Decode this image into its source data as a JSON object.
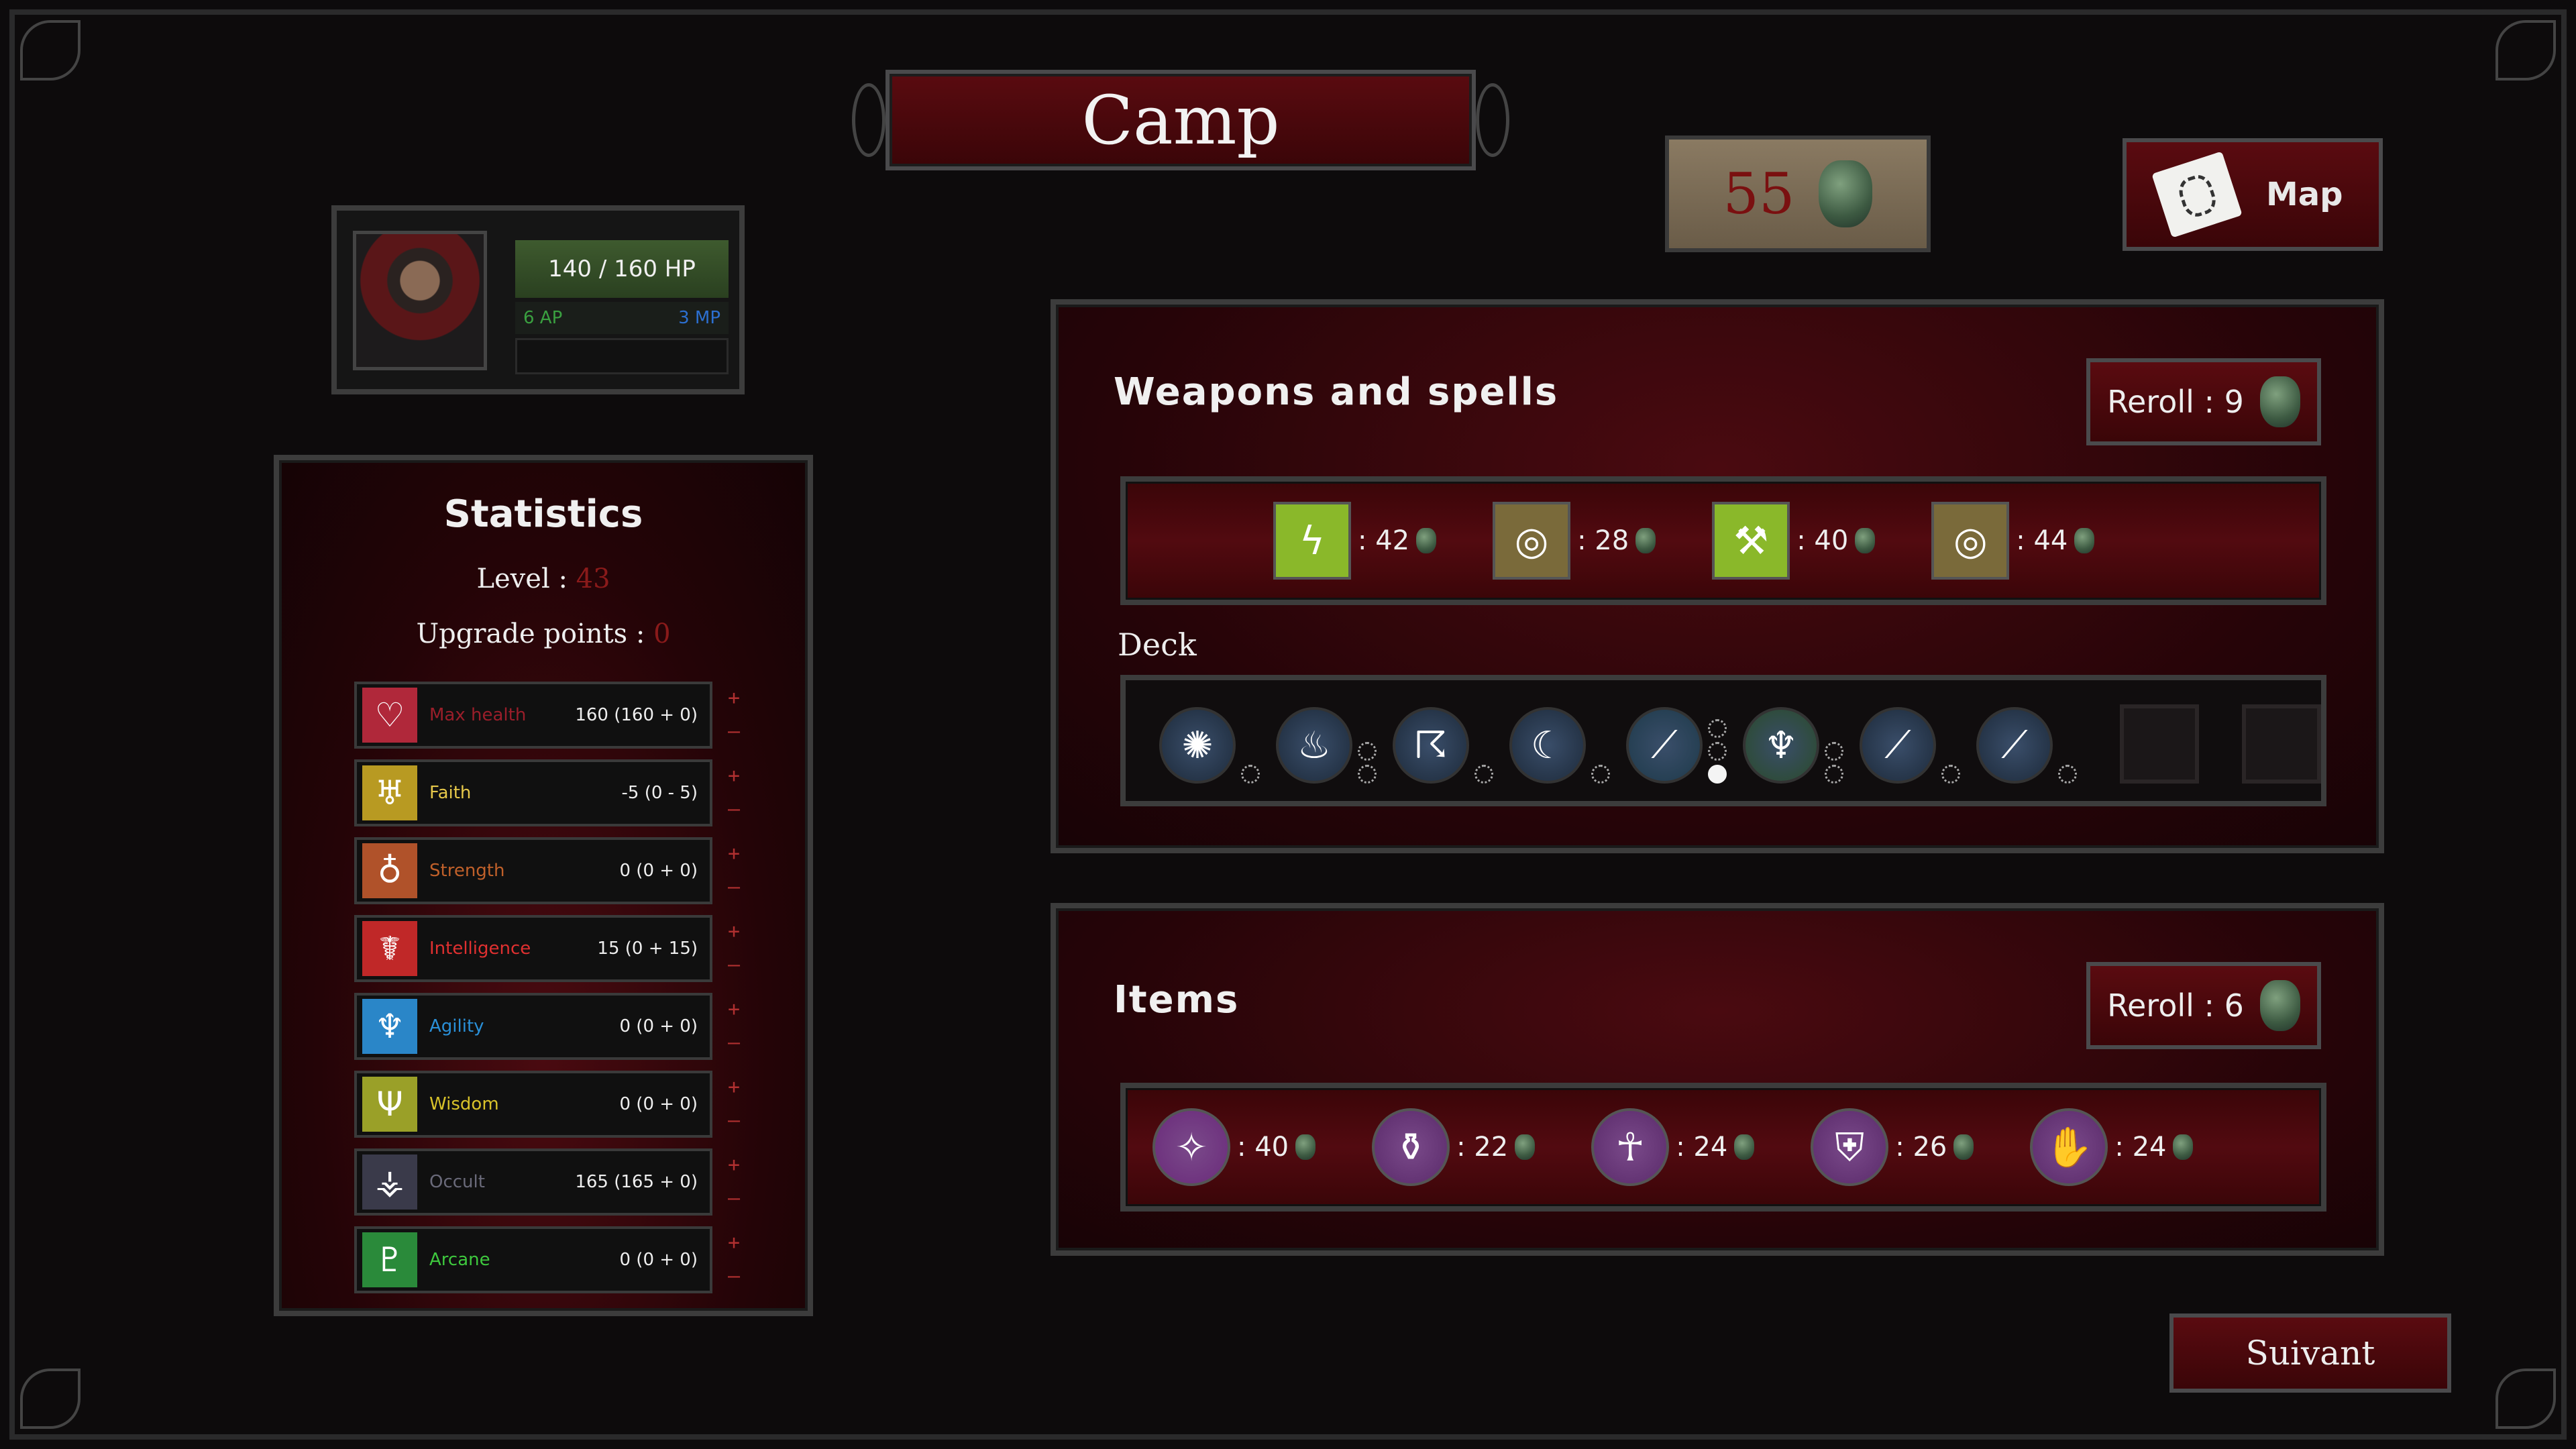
{
  "header": {
    "title": "Camp"
  },
  "currency": {
    "amount": "55",
    "icon": "gem-coin-icon"
  },
  "map_button": {
    "label": "Map",
    "icon": "map-scroll-icon"
  },
  "character": {
    "hp": "140 / 160 HP",
    "hp_fraction": 0.875,
    "ap": "6 AP",
    "mp": "3 MP",
    "hp_color": "#3e5a2e",
    "ap_color": "#3aa040",
    "mp_color": "#2c6fd0"
  },
  "statistics": {
    "title": "Statistics",
    "level_label": "Level : ",
    "level_value": "43",
    "upgrade_label": "Upgrade points : ",
    "upgrade_value": "0",
    "plus": "+",
    "minus": "–",
    "rows": [
      {
        "name": "Max health",
        "value": "160 (160 + 0)",
        "color": "#9a1e2a",
        "icon": "heart-sigil-icon",
        "bg": "#b0283a"
      },
      {
        "name": "Faith",
        "value": "-5 (0 - 5)",
        "color": "#e6c84a",
        "icon": "faith-sigil-icon",
        "bg": "#b89a22"
      },
      {
        "name": "Strength",
        "value": "0 (0 + 0)",
        "color": "#c0602a",
        "icon": "strength-sigil-icon",
        "bg": "#b0522a"
      },
      {
        "name": "Intelligence",
        "value": "15 (0 + 15)",
        "color": "#e03030",
        "icon": "intelligence-sigil-icon",
        "bg": "#c02828"
      },
      {
        "name": "Agility",
        "value": "0 (0 + 0)",
        "color": "#2a90d8",
        "icon": "agility-sigil-icon",
        "bg": "#2a86c8"
      },
      {
        "name": "Wisdom",
        "value": "0 (0 + 0)",
        "color": "#d8c22a",
        "icon": "wisdom-sigil-icon",
        "bg": "#9aa028"
      },
      {
        "name": "Occult",
        "value": "165 (165 + 0)",
        "color": "#6a6a7a",
        "icon": "occult-sigil-icon",
        "bg": "#3a3a4a"
      },
      {
        "name": "Arcane",
        "value": "0 (0 + 0)",
        "color": "#3ec83e",
        "icon": "arcane-sigil-icon",
        "bg": "#2a8a3a"
      }
    ]
  },
  "weapons": {
    "title": "Weapons and spells",
    "reroll_label": "Reroll : 9",
    "shop": [
      {
        "price": ": 42",
        "icon": "lightning-orb-icon",
        "bg": "#8ab82a"
      },
      {
        "price": ": 28",
        "icon": "ring-icon",
        "bg": "#7a6a3a"
      },
      {
        "price": ": 40",
        "icon": "hammer-icon",
        "bg": "#8ab82a"
      },
      {
        "price": ": 44",
        "icon": "ring-icon",
        "bg": "#7a6a3a"
      }
    ],
    "deck_label": "Deck",
    "deck": [
      {
        "icon": "bleeding-orb-icon",
        "bg": "#1d2a3a",
        "glyph": "✺",
        "dots": [
          0
        ]
      },
      {
        "icon": "flame-icon",
        "bg": "#1d2a3a",
        "glyph": "♨",
        "dots": [
          0,
          0
        ]
      },
      {
        "icon": "spirit-hand-icon",
        "bg": "#1d2a3a",
        "glyph": "☈",
        "dots": [
          0
        ]
      },
      {
        "icon": "claw-slash-icon",
        "bg": "#1d2a3a",
        "glyph": "☾",
        "dots": [
          0
        ]
      },
      {
        "icon": "bow-icon",
        "bg": "#1e3a4a",
        "glyph": "⟋",
        "dots": [
          0,
          0,
          1
        ]
      },
      {
        "icon": "fire-cloak-icon",
        "bg": "#2a4a2a",
        "glyph": "♆",
        "dots": [
          0,
          0
        ]
      },
      {
        "icon": "bow-icon",
        "bg": "#1d2a3a",
        "glyph": "⟋",
        "dots": [
          0
        ]
      },
      {
        "icon": "bow-icon",
        "bg": "#1d2a3a",
        "glyph": "⟋",
        "dots": [
          0
        ]
      }
    ],
    "empty_slots": 2
  },
  "items": {
    "title": "Items",
    "reroll_label": "Reroll : 6",
    "shop": [
      {
        "price": ": 40",
        "icon": "sparkle-wand-icon",
        "bg": "#6a2a7a",
        "glyph": "✧"
      },
      {
        "price": ": 22",
        "icon": "potion-bottle-icon",
        "bg": "#5a2a6a",
        "glyph": "⚱"
      },
      {
        "price": ": 24",
        "icon": "ankh-figure-icon",
        "bg": "#5a2a6a",
        "glyph": "☥"
      },
      {
        "price": ": 26",
        "icon": "armor-shirt-icon",
        "bg": "#5a2a6a",
        "glyph": "⛨"
      },
      {
        "price": ": 24",
        "icon": "open-hand-icon",
        "bg": "#5a2a6a",
        "glyph": "✋"
      }
    ]
  },
  "next_button": {
    "label": "Suivant"
  }
}
